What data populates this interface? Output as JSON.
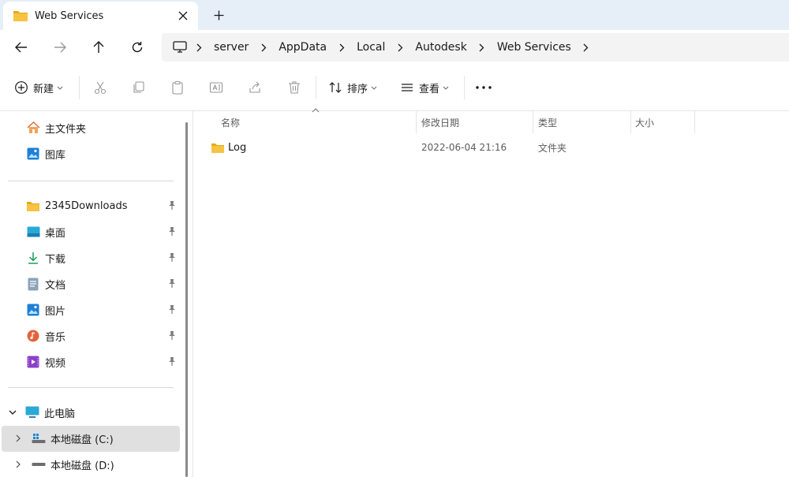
{
  "window": {
    "tab_title": "Web Services"
  },
  "address": {
    "crumbs": [
      "server",
      "AppData",
      "Local",
      "Autodesk",
      "Web Services"
    ]
  },
  "toolbar": {
    "new_label": "新建",
    "sort_label": "排序",
    "view_label": "查看"
  },
  "sidebar": {
    "quick": [
      {
        "label": "主文件夹",
        "icon": "home-icon"
      },
      {
        "label": "图库",
        "icon": "gallery-icon"
      }
    ],
    "pinned": [
      {
        "label": "2345Downloads",
        "icon": "folder-icon"
      },
      {
        "label": "桌面",
        "icon": "desktop-icon"
      },
      {
        "label": "下载",
        "icon": "download-icon"
      },
      {
        "label": "文档",
        "icon": "document-icon"
      },
      {
        "label": "图片",
        "icon": "pictures-icon"
      },
      {
        "label": "音乐",
        "icon": "music-icon"
      },
      {
        "label": "视频",
        "icon": "video-icon"
      }
    ],
    "this_pc": "此电脑",
    "drives": [
      {
        "label": "本地磁盘 (C:)",
        "icon": "drive-c-icon",
        "selected": true
      },
      {
        "label": "本地磁盘 (D:)",
        "icon": "drive-d-icon",
        "selected": false
      }
    ]
  },
  "columns": {
    "name": "名称",
    "modified": "修改日期",
    "type": "类型",
    "size": "大小"
  },
  "files": [
    {
      "name": "Log",
      "modified": "2022-06-04 21:16",
      "type": "文件夹",
      "size": ""
    }
  ],
  "colors": {
    "accent": "#0067c0",
    "folder": "#f6c342",
    "selected_bg": "#e0e0e0",
    "titlebar_bg": "#e6eef7"
  }
}
